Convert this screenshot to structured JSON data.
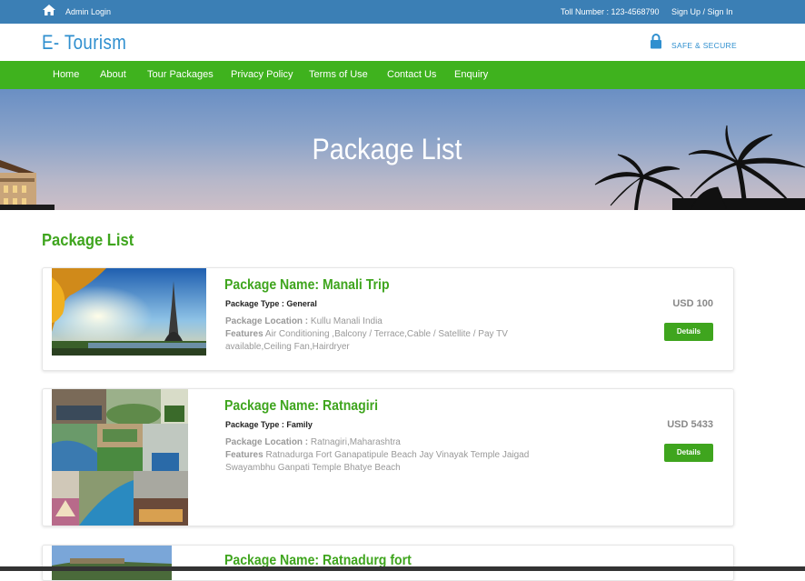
{
  "topbar": {
    "admin_login": "Admin Login",
    "toll_number": "Toll Number : 123-4568790",
    "signup_signin": "Sign Up / Sign In"
  },
  "header": {
    "logo": "E- Tourism",
    "secure_text": "SAFE & SECURE"
  },
  "nav": {
    "items": [
      "Home",
      "About",
      "Tour Packages",
      "Privacy Policy",
      "Terms of Use",
      "Contact Us",
      "Enquiry"
    ]
  },
  "banner": {
    "title": "Package List"
  },
  "section": {
    "title": "Package List"
  },
  "packages": [
    {
      "name": "Package Name: Manali Trip",
      "type": "Package Type : General",
      "location_label": "Package Location :",
      "location": "Kullu Manali India",
      "features_label": "Features",
      "features": "Air Conditioning ,Balcony / Terrace,Cable / Satellite / Pay TV available,Ceiling Fan,Hairdryer",
      "price": "USD 100",
      "details": "Details"
    },
    {
      "name": "Package Name: Ratnagiri",
      "type": "Package Type : Family",
      "location_label": "Package Location :",
      "location": "Ratnagiri,Maharashtra",
      "features_label": "Features",
      "features": "Ratnadurga Fort Ganapatipule Beach Jay Vinayak Temple Jaigad Swayambhu Ganpati Temple Bhatye Beach",
      "price": "USD 5433",
      "details": "Details"
    },
    {
      "name": "Package Name: Ratnadurg fort"
    }
  ],
  "colors": {
    "topbar": "#3b7fb5",
    "nav": "#3fb21e",
    "accent_green": "#3fa51e",
    "logo_blue": "#2f8fcf"
  }
}
